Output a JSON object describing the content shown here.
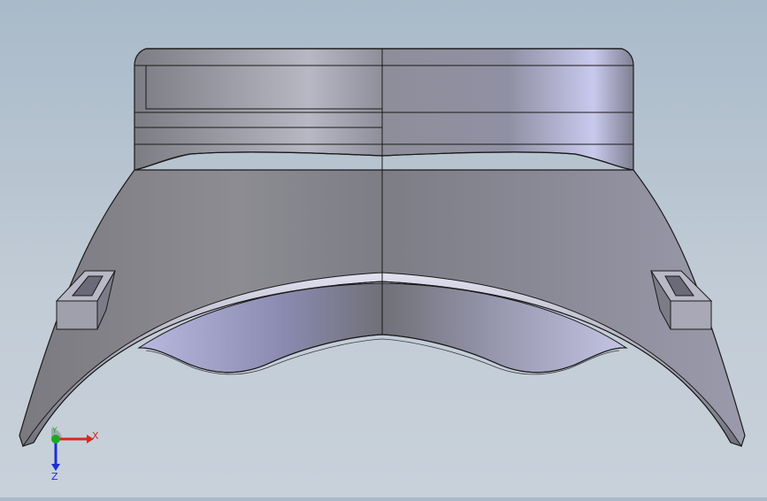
{
  "triad": {
    "x_label": "X",
    "y_label": "Y",
    "z_label": "Z",
    "colors": {
      "x": "#d52b1e",
      "y": "#1ea81e",
      "z": "#1b2fd6"
    }
  },
  "model": {
    "edge_color": "#1a1a1a",
    "body_color": "#8a8a96",
    "highlight_color": "#c8c8e6"
  }
}
